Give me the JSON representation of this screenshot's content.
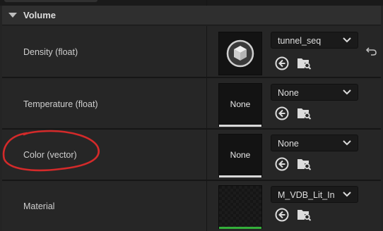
{
  "section": {
    "title": "Volume"
  },
  "rows": [
    {
      "label": "Density (float)",
      "thumbnail": "sphere-cube-asset",
      "asset_value": "tunnel_seq"
    },
    {
      "label": "Temperature (float)",
      "thumbnail_text": "None",
      "asset_value": "None"
    },
    {
      "label": "Color (vector)",
      "thumbnail_text": "None",
      "asset_value": "None"
    },
    {
      "label": "Material",
      "thumbnail": "checker-material",
      "asset_value": "M_VDB_Lit_In"
    }
  ],
  "icons": {
    "use_selected": "arrow-left-circle-icon",
    "browse": "folder-search-icon",
    "reset": "reset-arrow-icon",
    "dropdown": "chevron-down-icon"
  },
  "colors": {
    "annotation": "#d42a2a",
    "material_underline": "#34b03a",
    "panel_bg": "#242424"
  }
}
